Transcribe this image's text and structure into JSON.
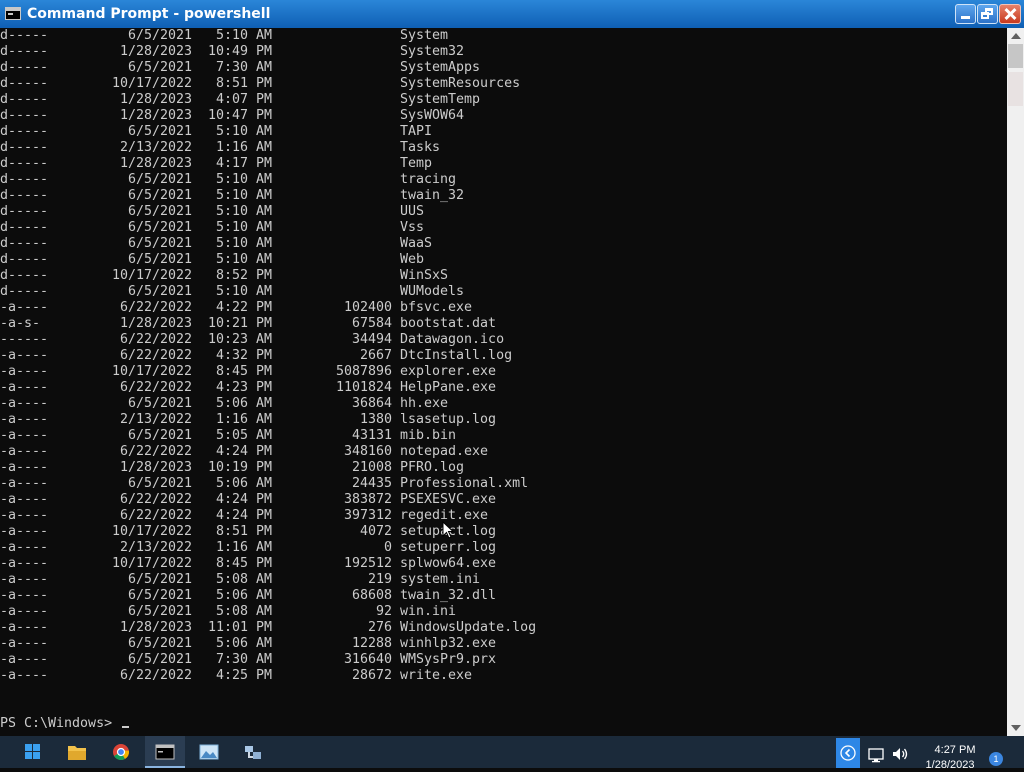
{
  "window": {
    "title": "Command Prompt - powershell"
  },
  "listing": [
    {
      "mode": "d-----",
      "date": "6/5/2021",
      "time": "5:10 AM",
      "length": "",
      "name": "System"
    },
    {
      "mode": "d-----",
      "date": "1/28/2023",
      "time": "10:49 PM",
      "length": "",
      "name": "System32"
    },
    {
      "mode": "d-----",
      "date": "6/5/2021",
      "time": "7:30 AM",
      "length": "",
      "name": "SystemApps"
    },
    {
      "mode": "d-----",
      "date": "10/17/2022",
      "time": "8:51 PM",
      "length": "",
      "name": "SystemResources"
    },
    {
      "mode": "d-----",
      "date": "1/28/2023",
      "time": "4:07 PM",
      "length": "",
      "name": "SystemTemp"
    },
    {
      "mode": "d-----",
      "date": "1/28/2023",
      "time": "10:47 PM",
      "length": "",
      "name": "SysWOW64"
    },
    {
      "mode": "d-----",
      "date": "6/5/2021",
      "time": "5:10 AM",
      "length": "",
      "name": "TAPI"
    },
    {
      "mode": "d-----",
      "date": "2/13/2022",
      "time": "1:16 AM",
      "length": "",
      "name": "Tasks"
    },
    {
      "mode": "d-----",
      "date": "1/28/2023",
      "time": "4:17 PM",
      "length": "",
      "name": "Temp"
    },
    {
      "mode": "d-----",
      "date": "6/5/2021",
      "time": "5:10 AM",
      "length": "",
      "name": "tracing"
    },
    {
      "mode": "d-----",
      "date": "6/5/2021",
      "time": "5:10 AM",
      "length": "",
      "name": "twain_32"
    },
    {
      "mode": "d-----",
      "date": "6/5/2021",
      "time": "5:10 AM",
      "length": "",
      "name": "UUS"
    },
    {
      "mode": "d-----",
      "date": "6/5/2021",
      "time": "5:10 AM",
      "length": "",
      "name": "Vss"
    },
    {
      "mode": "d-----",
      "date": "6/5/2021",
      "time": "5:10 AM",
      "length": "",
      "name": "WaaS"
    },
    {
      "mode": "d-----",
      "date": "6/5/2021",
      "time": "5:10 AM",
      "length": "",
      "name": "Web"
    },
    {
      "mode": "d-----",
      "date": "10/17/2022",
      "time": "8:52 PM",
      "length": "",
      "name": "WinSxS"
    },
    {
      "mode": "d-----",
      "date": "6/5/2021",
      "time": "5:10 AM",
      "length": "",
      "name": "WUModels"
    },
    {
      "mode": "-a----",
      "date": "6/22/2022",
      "time": "4:22 PM",
      "length": "102400",
      "name": "bfsvc.exe"
    },
    {
      "mode": "-a-s-",
      "date": "1/28/2023",
      "time": "10:21 PM",
      "length": "67584",
      "name": "bootstat.dat"
    },
    {
      "mode": "------",
      "date": "6/22/2022",
      "time": "10:23 AM",
      "length": "34494",
      "name": "Datawagon.ico"
    },
    {
      "mode": "-a----",
      "date": "6/22/2022",
      "time": "4:32 PM",
      "length": "2667",
      "name": "DtcInstall.log"
    },
    {
      "mode": "-a----",
      "date": "10/17/2022",
      "time": "8:45 PM",
      "length": "5087896",
      "name": "explorer.exe"
    },
    {
      "mode": "-a----",
      "date": "6/22/2022",
      "time": "4:23 PM",
      "length": "1101824",
      "name": "HelpPane.exe"
    },
    {
      "mode": "-a----",
      "date": "6/5/2021",
      "time": "5:06 AM",
      "length": "36864",
      "name": "hh.exe"
    },
    {
      "mode": "-a----",
      "date": "2/13/2022",
      "time": "1:16 AM",
      "length": "1380",
      "name": "lsasetup.log"
    },
    {
      "mode": "-a----",
      "date": "6/5/2021",
      "time": "5:05 AM",
      "length": "43131",
      "name": "mib.bin"
    },
    {
      "mode": "-a----",
      "date": "6/22/2022",
      "time": "4:24 PM",
      "length": "348160",
      "name": "notepad.exe"
    },
    {
      "mode": "-a----",
      "date": "1/28/2023",
      "time": "10:19 PM",
      "length": "21008",
      "name": "PFRO.log"
    },
    {
      "mode": "-a----",
      "date": "6/5/2021",
      "time": "5:06 AM",
      "length": "24435",
      "name": "Professional.xml"
    },
    {
      "mode": "-a----",
      "date": "6/22/2022",
      "time": "4:24 PM",
      "length": "383872",
      "name": "PSEXESVC.exe"
    },
    {
      "mode": "-a----",
      "date": "6/22/2022",
      "time": "4:24 PM",
      "length": "397312",
      "name": "regedit.exe"
    },
    {
      "mode": "-a----",
      "date": "10/17/2022",
      "time": "8:51 PM",
      "length": "4072",
      "name": "setupact.log"
    },
    {
      "mode": "-a----",
      "date": "2/13/2022",
      "time": "1:16 AM",
      "length": "0",
      "name": "setuperr.log"
    },
    {
      "mode": "-a----",
      "date": "10/17/2022",
      "time": "8:45 PM",
      "length": "192512",
      "name": "splwow64.exe"
    },
    {
      "mode": "-a----",
      "date": "6/5/2021",
      "time": "5:08 AM",
      "length": "219",
      "name": "system.ini"
    },
    {
      "mode": "-a----",
      "date": "6/5/2021",
      "time": "5:06 AM",
      "length": "68608",
      "name": "twain_32.dll"
    },
    {
      "mode": "-a----",
      "date": "6/5/2021",
      "time": "5:08 AM",
      "length": "92",
      "name": "win.ini"
    },
    {
      "mode": "-a----",
      "date": "1/28/2023",
      "time": "11:01 PM",
      "length": "276",
      "name": "WindowsUpdate.log"
    },
    {
      "mode": "-a----",
      "date": "6/5/2021",
      "time": "5:06 AM",
      "length": "12288",
      "name": "winhlp32.exe"
    },
    {
      "mode": "-a----",
      "date": "6/5/2021",
      "time": "7:30 AM",
      "length": "316640",
      "name": "WMSysPr9.prx"
    },
    {
      "mode": "-a----",
      "date": "6/22/2022",
      "time": "4:25 PM",
      "length": "28672",
      "name": "write.exe"
    }
  ],
  "prompt": "PS C:\\Windows> ",
  "taskbar": {
    "time": "4:27 PM",
    "date": "1/28/2023",
    "notification_count": "1",
    "apps": [
      "start-icon",
      "file-explorer-icon",
      "chrome-icon",
      "command-prompt-icon",
      "photos-icon",
      "network-tool-icon"
    ]
  },
  "colors": {
    "console_bg": "#0c0c0c",
    "console_text": "#cccccc",
    "title_bar": "#1c6fc9",
    "taskbar": "#1b2a3a"
  }
}
